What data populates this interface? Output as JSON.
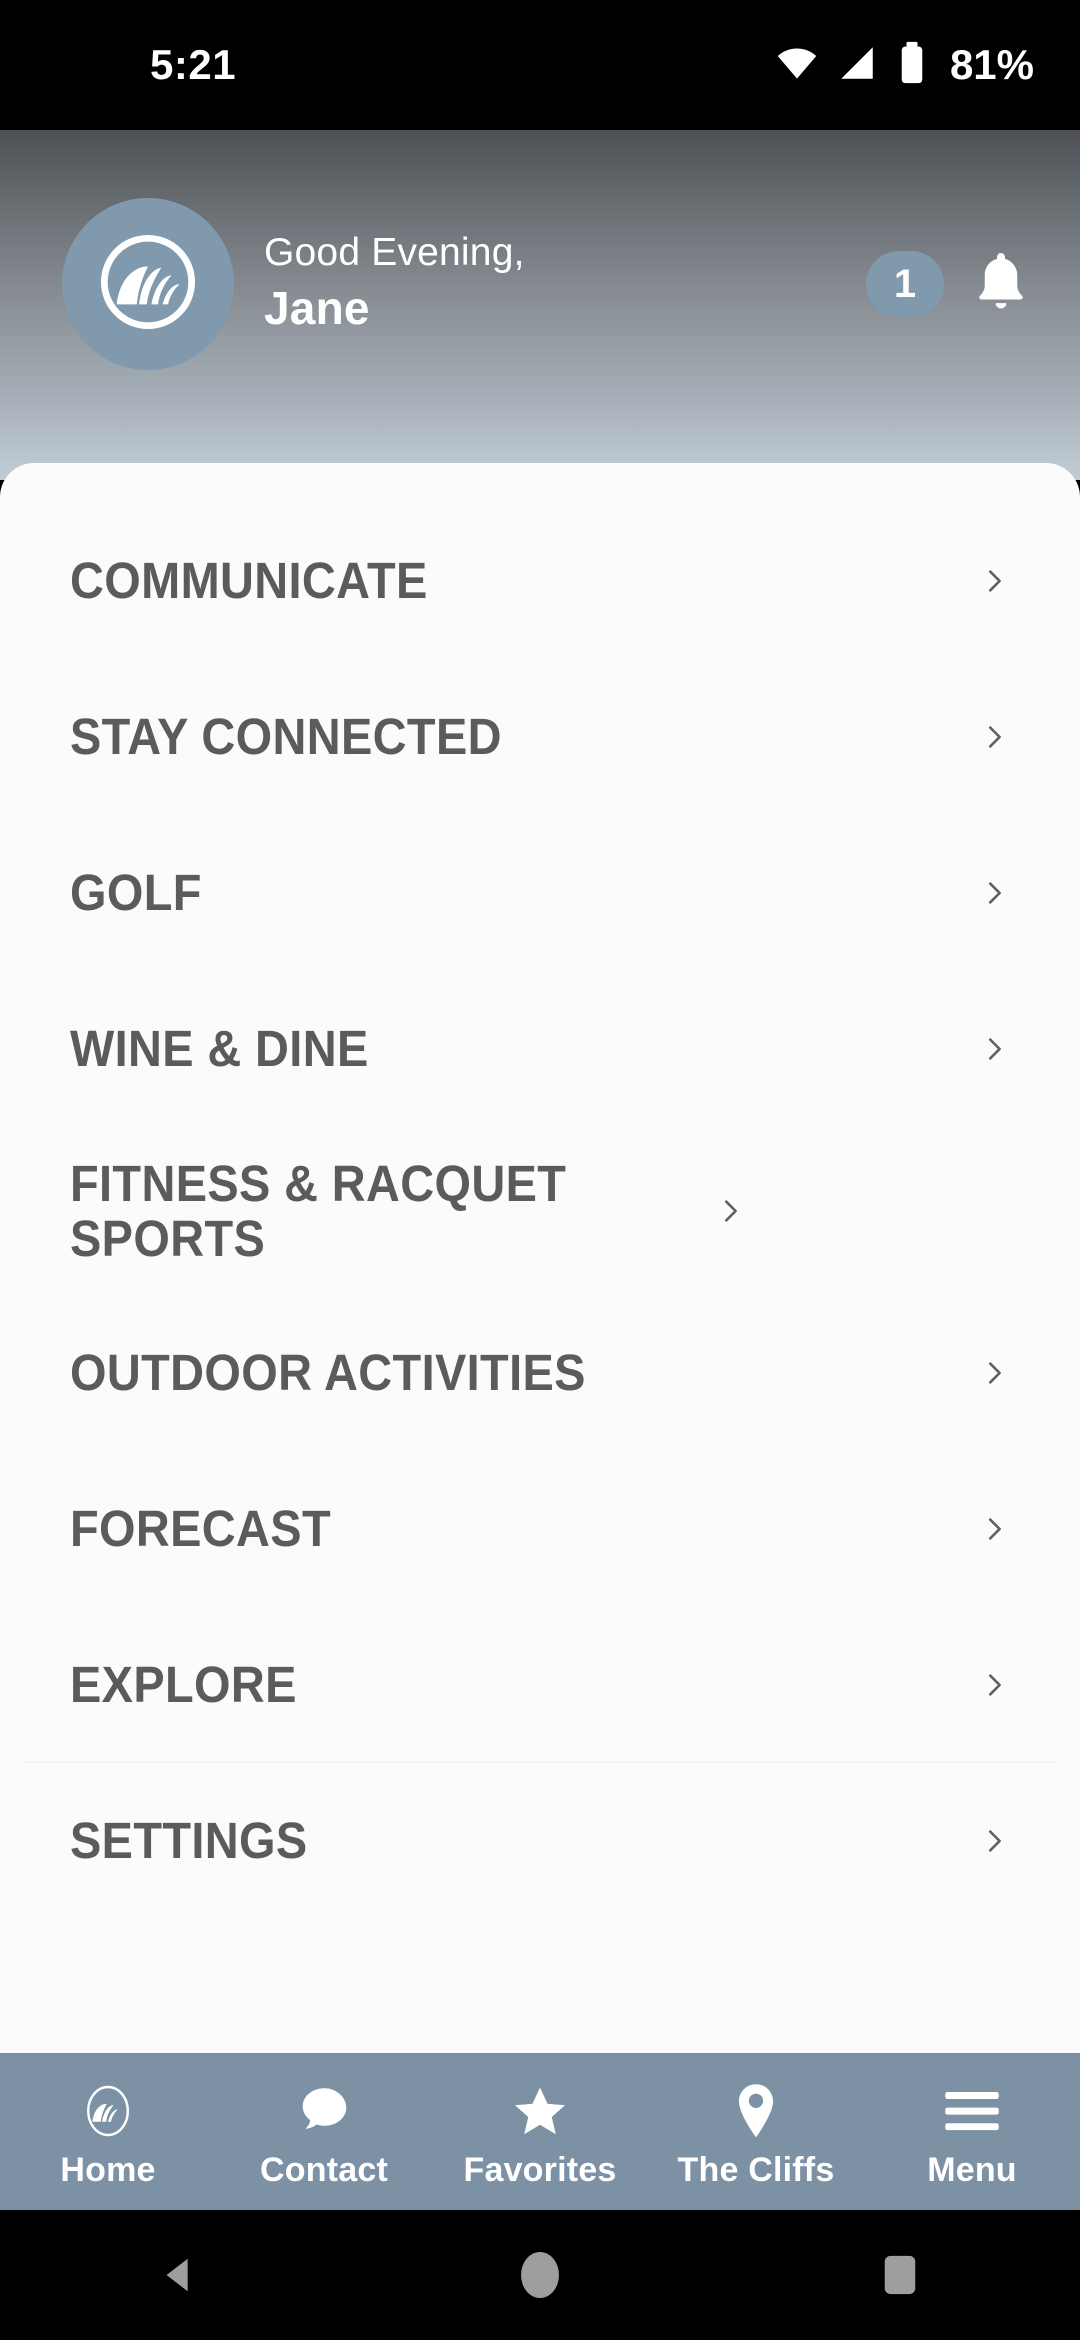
{
  "status_bar": {
    "time": "5:21",
    "battery_percent": "81%",
    "icons": [
      "wifi-icon",
      "cellular-signal-icon",
      "battery-icon"
    ]
  },
  "header": {
    "avatar_icon": "cliffs-logo-icon",
    "greeting": "Good Evening,",
    "user_name": "Jane",
    "notification_count": "1",
    "bell_icon": "bell-icon",
    "badge_color": "#8199ad"
  },
  "menu": {
    "items": [
      {
        "label": "COMMUNICATE",
        "chevron": "chevron-right-icon",
        "divider": false
      },
      {
        "label": "STAY CONNECTED",
        "chevron": "chevron-right-icon",
        "divider": false
      },
      {
        "label": "GOLF",
        "chevron": "chevron-right-icon",
        "divider": false
      },
      {
        "label": "WINE & DINE",
        "chevron": "chevron-right-icon",
        "divider": false
      },
      {
        "label": "FITNESS & RACQUET SPORTS",
        "chevron": "chevron-right-icon",
        "divider": false
      },
      {
        "label": "OUTDOOR ACTIVITIES",
        "chevron": "chevron-right-icon",
        "divider": false
      },
      {
        "label": "FORECAST",
        "chevron": "chevron-right-icon",
        "divider": false
      },
      {
        "label": "EXPLORE",
        "chevron": "chevron-right-icon",
        "divider": true
      },
      {
        "label": "SETTINGS",
        "chevron": "chevron-right-icon",
        "divider": false
      }
    ]
  },
  "tab_bar": {
    "background_color": "#7d91a5",
    "items": [
      {
        "label": "Home",
        "icon": "cliffs-logo-icon"
      },
      {
        "label": "Contact",
        "icon": "speech-bubble-icon"
      },
      {
        "label": "Favorites",
        "icon": "star-icon"
      },
      {
        "label": "The Cliffs",
        "icon": "location-pin-icon"
      },
      {
        "label": "Menu",
        "icon": "hamburger-menu-icon"
      }
    ]
  },
  "android_nav": {
    "buttons": [
      "back-button",
      "home-button",
      "recents-button"
    ]
  }
}
